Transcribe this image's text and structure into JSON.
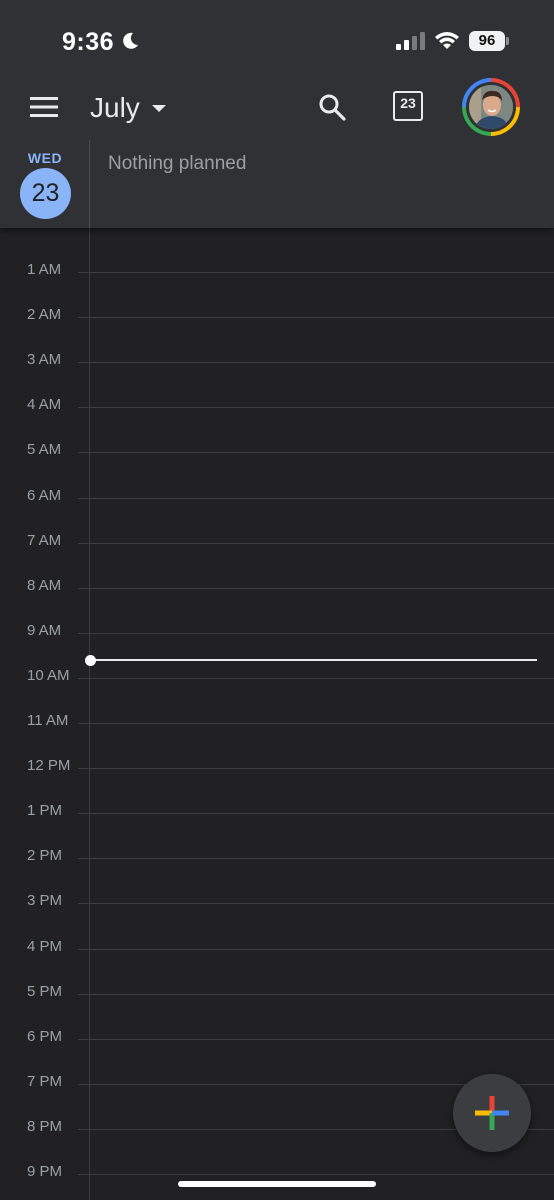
{
  "status_bar": {
    "time": "9:36",
    "battery": "96"
  },
  "top_bar": {
    "month": "July",
    "today_icon_day": "23"
  },
  "day_header": {
    "weekday": "WED",
    "day": "23",
    "all_day_text": "Nothing planned"
  },
  "hours": [
    "1 AM",
    "2 AM",
    "3 AM",
    "4 AM",
    "5 AM",
    "6 AM",
    "7 AM",
    "8 AM",
    "9 AM",
    "10 AM",
    "11 AM",
    "12 PM",
    "1 PM",
    "2 PM",
    "3 PM",
    "4 PM",
    "5 PM",
    "6 PM",
    "7 PM",
    "8 PM",
    "9 PM"
  ],
  "colors": {
    "accent": "#8ab4f8",
    "background": "#212124",
    "header": "#303134",
    "fab_red": "#ea4335",
    "fab_yellow": "#fbbc04",
    "fab_green": "#34a853",
    "fab_blue": "#4285f4"
  },
  "icons": [
    "moon-icon",
    "signal-icon",
    "wifi-icon",
    "battery-icon",
    "menu-icon",
    "caret-down-icon",
    "search-icon",
    "today-icon",
    "avatar",
    "add-icon"
  ]
}
